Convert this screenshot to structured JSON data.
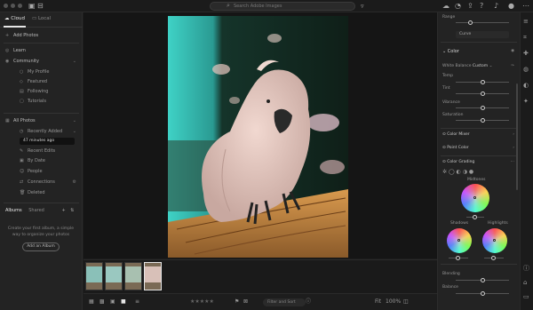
{
  "topbar": {
    "search_placeholder": "Search Adobe Images"
  },
  "sidebar": {
    "tabs": [
      {
        "label": "Cloud"
      },
      {
        "label": "Local"
      }
    ],
    "add_photos": "Add Photos",
    "learn": "Learn",
    "community": "Community",
    "community_items": [
      {
        "label": "My Profile"
      },
      {
        "label": "Featured"
      },
      {
        "label": "Following"
      },
      {
        "label": "Tutorials"
      }
    ],
    "all_photos": "All Photos",
    "recently_added": "Recently Added",
    "tooltip": "47 minutes ago",
    "lower_items": [
      {
        "label": "Recent Edits"
      },
      {
        "label": "By Date"
      },
      {
        "label": "People"
      },
      {
        "label": "Connections"
      },
      {
        "label": "Deleted"
      }
    ],
    "albums_tab": "Albums",
    "shared_tab": "Shared",
    "album_hint": "Create your first album, a simple way to organize your photos",
    "new_album_button": "Add an Album"
  },
  "bottombar": {
    "filter_placeholder": "Filter and Sort",
    "fit_label": "Fit",
    "zoom": "100%"
  },
  "rightpanel": {
    "curve_label": "Curve",
    "color_section": "Color",
    "white_balance_label": "White Balance",
    "white_balance_value": "Custom",
    "sliders": [
      {
        "label": "Temp"
      },
      {
        "label": "Tint"
      },
      {
        "label": "Vibrance"
      },
      {
        "label": "Saturation"
      }
    ],
    "color_mixer": "Color Mixer",
    "point_color": "Point Color",
    "color_grading": "Color Grading",
    "midtones": "Midtones",
    "shadows": "Shadows",
    "highlights": "Highlights",
    "blending": "Blending",
    "balance": "Balance"
  }
}
